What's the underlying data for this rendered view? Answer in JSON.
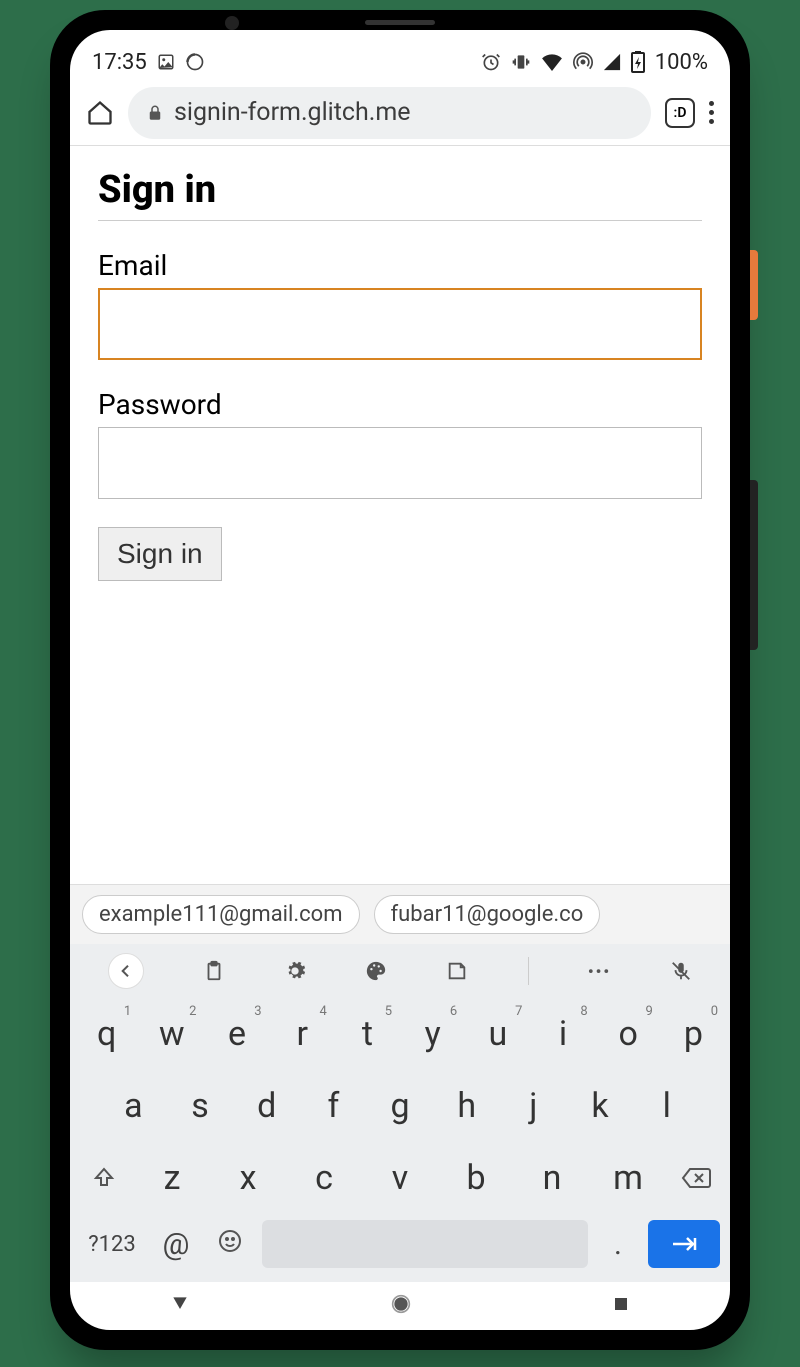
{
  "statusbar": {
    "time": "17:35",
    "battery": "100%"
  },
  "browser": {
    "url": "signin-form.glitch.me",
    "tab_indicator": ":D"
  },
  "page": {
    "title": "Sign in",
    "email_label": "Email",
    "email_value": "",
    "password_label": "Password",
    "password_value": "",
    "submit_label": "Sign in"
  },
  "suggestions": [
    "example111@gmail.com",
    "fubar11@google.co"
  ],
  "keyboard": {
    "row1": [
      {
        "k": "q",
        "n": "1"
      },
      {
        "k": "w",
        "n": "2"
      },
      {
        "k": "e",
        "n": "3"
      },
      {
        "k": "r",
        "n": "4"
      },
      {
        "k": "t",
        "n": "5"
      },
      {
        "k": "y",
        "n": "6"
      },
      {
        "k": "u",
        "n": "7"
      },
      {
        "k": "i",
        "n": "8"
      },
      {
        "k": "o",
        "n": "9"
      },
      {
        "k": "p",
        "n": "0"
      }
    ],
    "row2": [
      "a",
      "s",
      "d",
      "f",
      "g",
      "h",
      "j",
      "k",
      "l"
    ],
    "row3": [
      "z",
      "x",
      "c",
      "v",
      "b",
      "n",
      "m"
    ],
    "sym_label": "?123",
    "at_label": "@",
    "dot_label": "."
  }
}
